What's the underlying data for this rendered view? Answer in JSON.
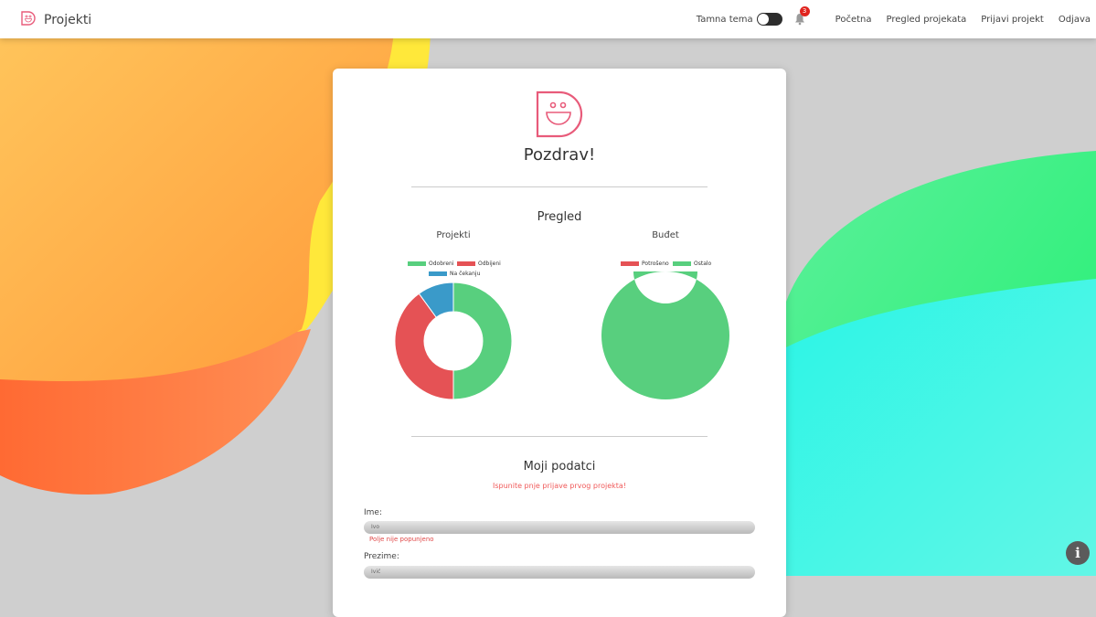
{
  "app": {
    "title": "Projekti"
  },
  "nav": {
    "dark_theme_label": "Tamna tema",
    "notifications_count": "3",
    "links": [
      "Početna",
      "Pregled projekata",
      "Prijavi projekt",
      "Odjava"
    ]
  },
  "card": {
    "greeting": "Pozdrav!",
    "overview_title": "Pregled",
    "projects_chart_title": "Projekti",
    "budget_chart_title": "Buđet",
    "my_data_title": "Moji podatci",
    "warning": "Ispunite pnje prijave prvog projekta!",
    "fields": {
      "ime_label": "Ime:",
      "ime_value": "Ivo",
      "ime_error": "Polje nije popunjeno",
      "prezime_label": "Prezime:",
      "prezime_value": "Ivić"
    }
  },
  "colors": {
    "accent": "#e85b7a",
    "green": "#58cf7e",
    "red": "#e55255",
    "blue": "#3a9ac9"
  },
  "chart_data": [
    {
      "type": "pie",
      "title": "Projekti",
      "categories": [
        "Odobreni",
        "Odbijeni",
        "Na čekanju"
      ],
      "values": [
        50,
        40,
        10
      ],
      "colors": [
        "#58cf7e",
        "#e55255",
        "#3a9ac9"
      ],
      "legend": "top"
    },
    {
      "type": "pie",
      "title": "Buđet",
      "categories": [
        "Potrošeno",
        "Ostalo"
      ],
      "values": [
        0,
        100
      ],
      "colors": [
        "#e55255",
        "#58cf7e"
      ],
      "legend": "top"
    }
  ]
}
